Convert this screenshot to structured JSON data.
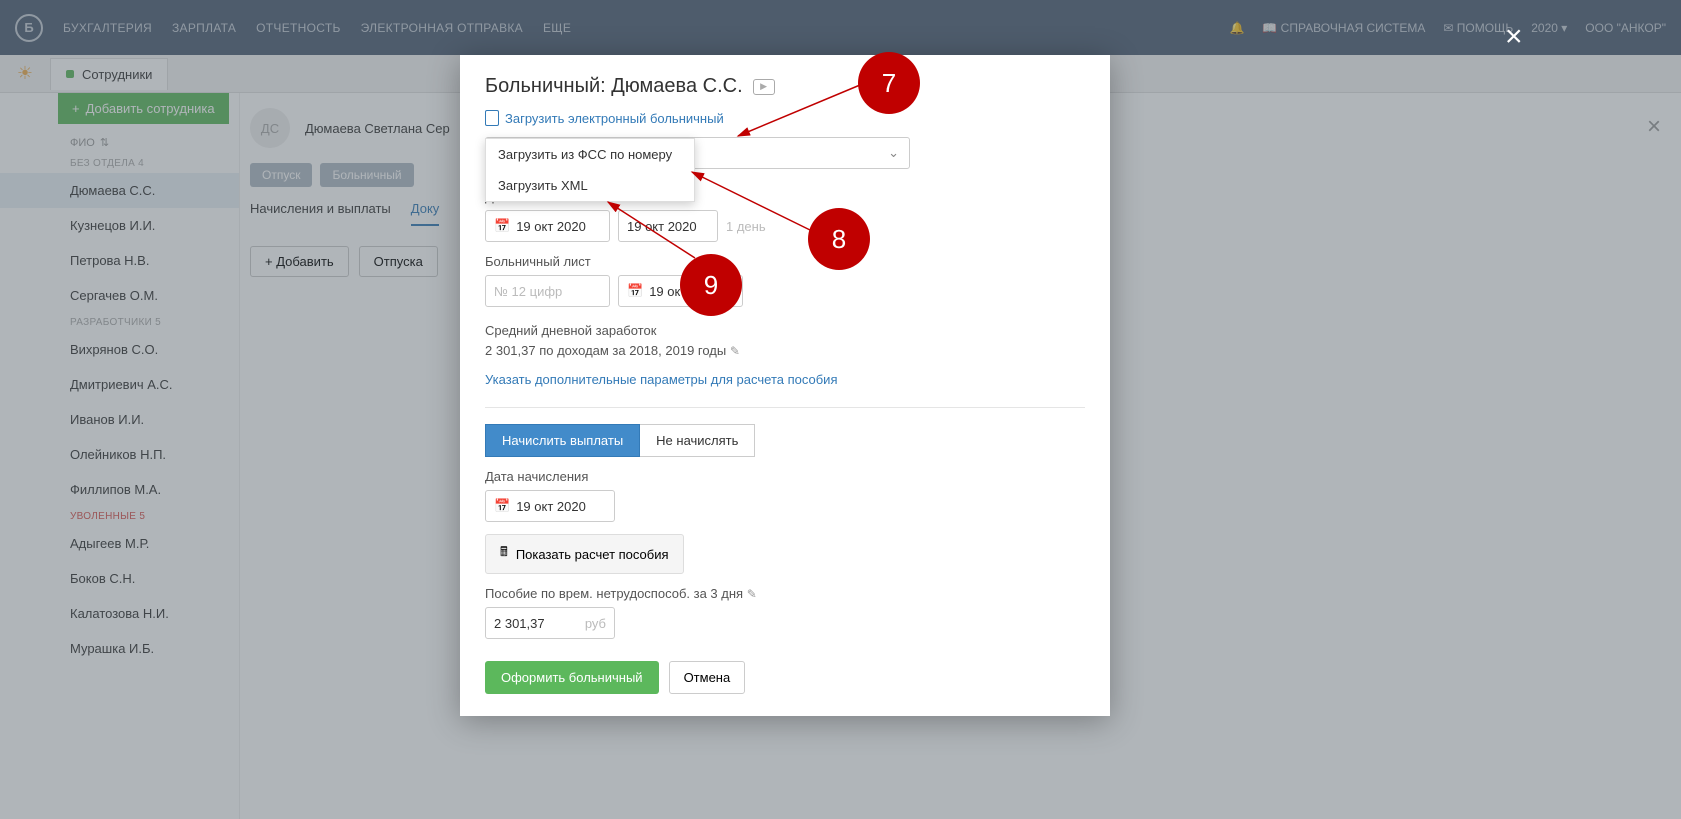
{
  "top_nav": {
    "items": [
      "БУХГАЛТЕРИЯ",
      "ЗАРПЛАТА",
      "ОТЧЕТНОСТЬ",
      "ЭЛЕКТРОННАЯ ОТПРАВКА",
      "ЕЩЕ"
    ]
  },
  "top_right": {
    "help_system": "СПРАВОЧНАЯ СИСТЕМА",
    "help": "ПОМОЩЬ",
    "year": "2020",
    "company": "ООО \"АНКОР\""
  },
  "tab": "Сотрудники",
  "sidebar": {
    "add": "Добавить сотрудника",
    "filter": "ФИО",
    "dept1": "БЕЗ ОТДЕЛА 4",
    "dept2": "РАЗРАБОТЧИКИ 5",
    "dept3": "УВОЛЕННЫЕ 5",
    "emp": [
      "Дюмаева С.С.",
      "Кузнецов И.И.",
      "Петрова Н.В.",
      "Сергачев О.М.",
      "Вихрянов С.О.",
      "Дмитриевич А.С.",
      "Иванов И.И.",
      "Олейников Н.П.",
      "Филлипов М.А.",
      "Адыгеев М.Р.",
      "Боков С.Н.",
      "Калатозова Н.И.",
      "Мурашка И.Б."
    ]
  },
  "main": {
    "avatar": "ДС",
    "name": "Дюмаева Светлана Сер",
    "chips": [
      "Отпуск",
      "Больничный"
    ],
    "tabs": [
      "Начисления и выплаты",
      "Доку"
    ],
    "add_doc": "Добавить",
    "vac": "Отпуска"
  },
  "dlg": {
    "title": "Больничный: Дюмаева С.С.",
    "load_link": "Загрузить электронный больничный",
    "dd1": "Загрузить из ФСС по номеру",
    "dd2": "Загрузить XML",
    "dates_label": "Даты больничного",
    "date1": "19 окт 2020",
    "date2": "19 окт 2020",
    "days": "1 день",
    "sheet_label": "Больничный лист",
    "num_placeholder": "№ 12 цифр",
    "date3": "19 ок",
    "avg_label": "Средний дневной заработок",
    "avg_text": "2 301,37 по доходам за 2018, 2019 годы",
    "params_link": "Указать дополнительные параметры для расчета пособия",
    "accrue": "Начислить выплаты",
    "no_accrue": "Не начислять",
    "accrue_date_label": "Дата начисления",
    "accrue_date": "19 окт 2020",
    "show_calc": "Показать расчет пособия",
    "benefit_label": "Пособие по врем. нетрудоспособ. за 3 дня",
    "amount": "2 301,37",
    "cur": "руб",
    "submit": "Оформить больничный",
    "cancel": "Отмена"
  },
  "callouts": {
    "c7": "7",
    "c8": "8",
    "c9": "9"
  }
}
